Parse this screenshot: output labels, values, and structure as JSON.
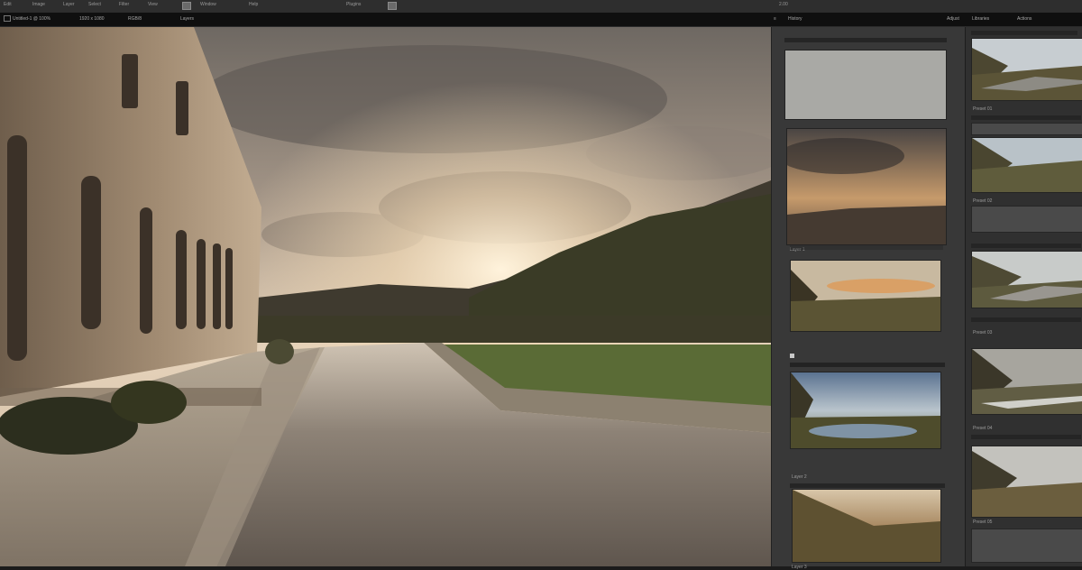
{
  "menu": {
    "items": [
      "Edit",
      "Image",
      "Layer",
      "Select",
      "Filter",
      "View",
      "Window",
      "Help",
      "Plugins"
    ],
    "zoom": "2.00"
  },
  "toolbar": {
    "doc_tab": "Untitled-1 @ 100%",
    "size": "1920 x 1080",
    "mode": "RGB/8",
    "layers_tab": "Layers",
    "panel_tabs": [
      "History",
      "Adjust",
      "Libraries",
      "Actions"
    ]
  },
  "panel_mid": {
    "section_labels": [
      "Layer 1",
      "Layer 2",
      "Layer 3"
    ]
  },
  "panel_right": {
    "captions": [
      "Preset 01",
      "Preset 02",
      "Preset 03",
      "Preset 04",
      "Preset 05"
    ]
  },
  "colors": {
    "accent": "#d9a066",
    "panel": "#383838",
    "panel_dark": "#303030",
    "bar": "#0f0f0f"
  }
}
